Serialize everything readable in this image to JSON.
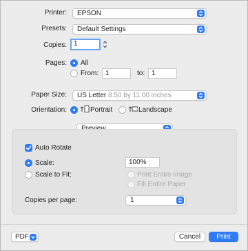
{
  "printer": {
    "label": "Printer:",
    "value": "EPSON"
  },
  "presets": {
    "label": "Presets:",
    "value": "Default Settings"
  },
  "copies": {
    "label": "Copies:",
    "value": "1"
  },
  "pages": {
    "label": "Pages:",
    "all_label": "All",
    "from_label": "From:",
    "from_value": "1",
    "to_label": "to:",
    "to_value": "1",
    "selected": "All"
  },
  "paper_size": {
    "label": "Paper Size:",
    "value": "US Letter",
    "dimensions": "8.50 by 11.00 inches"
  },
  "orientation": {
    "label": "Orientation:",
    "portrait_label": "Portrait",
    "landscape_label": "Landscape",
    "selected": "Portrait"
  },
  "section_menu": {
    "value": "Preview"
  },
  "preview": {
    "auto_rotate_label": "Auto Rotate",
    "auto_rotate_checked": true,
    "scale_label": "Scale:",
    "scale_value": "100%",
    "scale_to_fit_label": "Scale to Fit:",
    "print_entire_image_label": "Print Entire Image",
    "fill_entire_paper_label": "Fill Entire Paper",
    "copies_per_page_label": "Copies per page:",
    "copies_per_page_value": "1"
  },
  "footer": {
    "pdf_label": "PDF",
    "cancel_label": "Cancel",
    "print_label": "Print"
  },
  "colors": {
    "accent": "#2f7bf5",
    "background": "#ececec"
  }
}
